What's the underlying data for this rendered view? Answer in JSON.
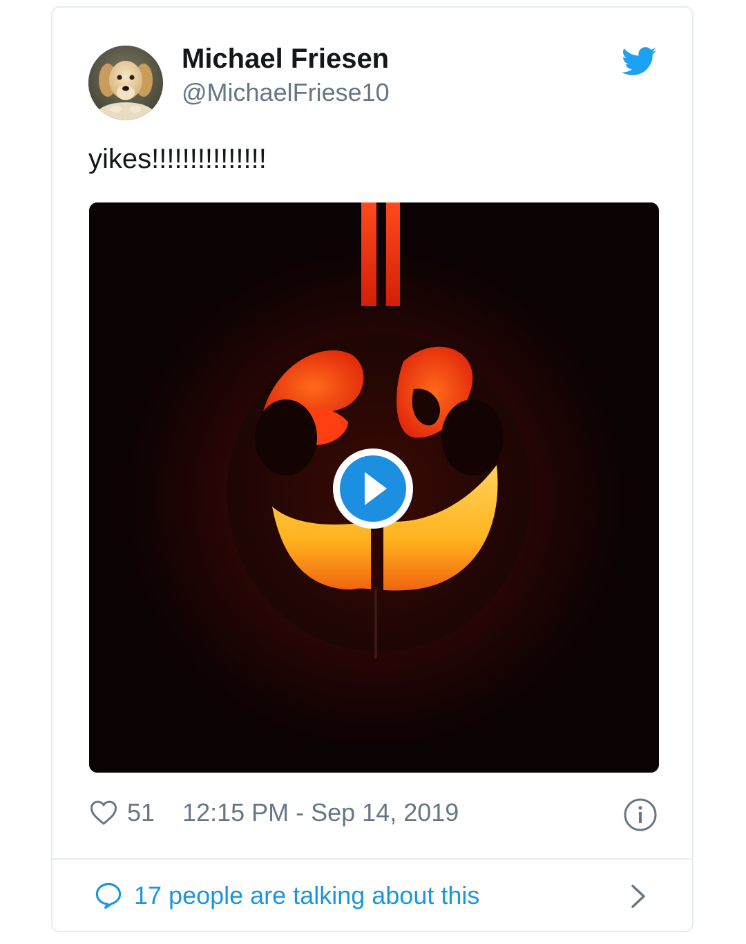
{
  "tweet": {
    "author_name": "Michael Friesen",
    "author_handle": "@MichaelFriese10",
    "text": "yikes!!!!!!!!!!!!!!!",
    "likes": "51",
    "timestamp": "12:15 PM - Sep 14, 2019",
    "conversation_label": "17 people are talking about this"
  },
  "icons": {
    "brand": "twitter-bird-icon",
    "like": "heart-icon",
    "info": "info-icon",
    "reply": "speech-bubble-icon",
    "more": "chevron-right-icon",
    "play": "play-icon"
  },
  "colors": {
    "brand_blue": "#1da1f2",
    "link_blue": "#1b95e0",
    "secondary_text": "#657786",
    "primary_text": "#14171a",
    "border": "#e6ecf0"
  }
}
